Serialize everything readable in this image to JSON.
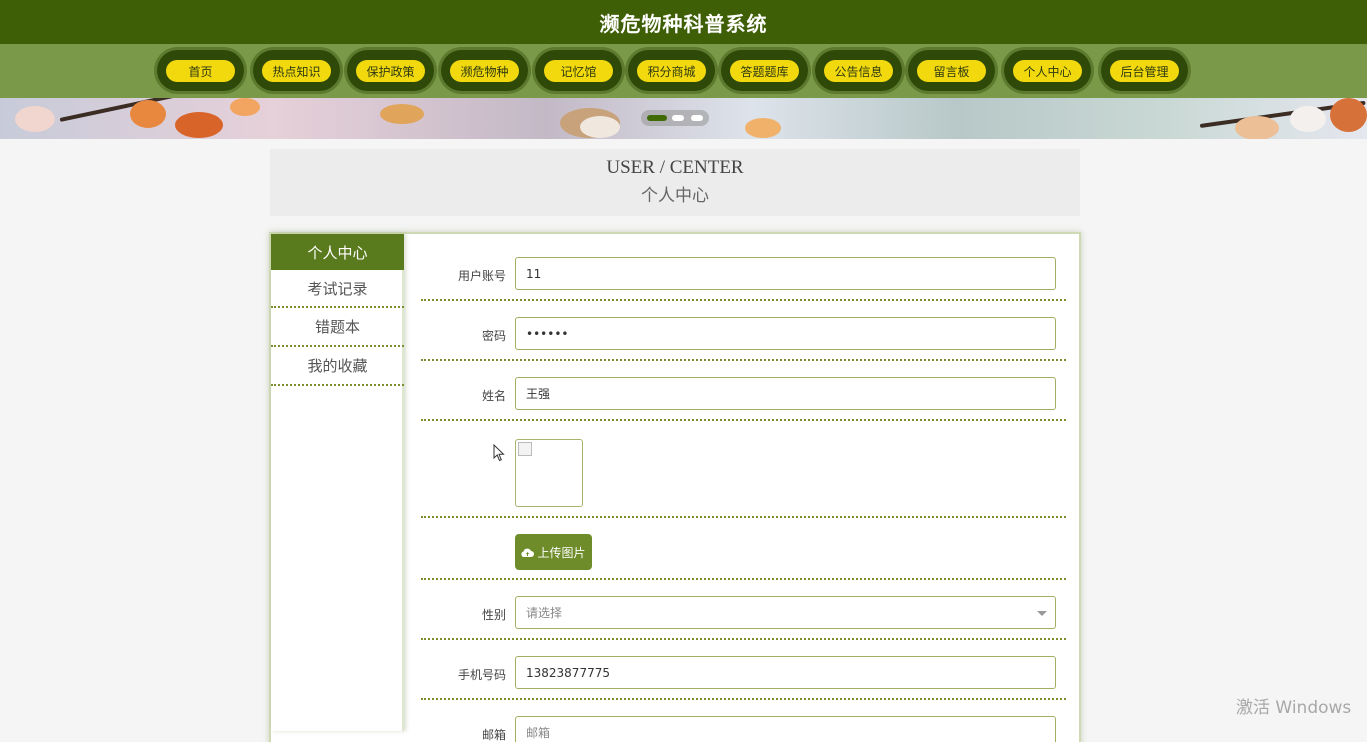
{
  "header": {
    "title": "濒危物种科普系统"
  },
  "nav": {
    "items": [
      {
        "label": "首页"
      },
      {
        "label": "热点知识"
      },
      {
        "label": "保护政策"
      },
      {
        "label": "濒危物种"
      },
      {
        "label": "记忆馆"
      },
      {
        "label": "积分商城"
      },
      {
        "label": "答题题库"
      },
      {
        "label": "公告信息"
      },
      {
        "label": "留言板"
      },
      {
        "label": "个人中心"
      },
      {
        "label": "后台管理"
      }
    ]
  },
  "banner": {
    "slides": 3,
    "active_slide": 1
  },
  "center_header": {
    "en": "USER / CENTER",
    "cn": "个人中心"
  },
  "sidebar": {
    "items": [
      {
        "label": "个人中心",
        "active": true
      },
      {
        "label": "考试记录",
        "active": false
      },
      {
        "label": "错题本",
        "active": false
      },
      {
        "label": "我的收藏",
        "active": false
      }
    ]
  },
  "form": {
    "account_label": "用户账号",
    "account_value": "11",
    "password_label": "密码",
    "password_value": "••••••",
    "name_label": "姓名",
    "name_value": "王强",
    "upload_label": "上传图片",
    "gender_label": "性别",
    "gender_placeholder": "请选择",
    "phone_label": "手机号码",
    "phone_value": "13823877775",
    "email_label": "邮箱",
    "email_placeholder": "邮箱"
  },
  "colors": {
    "header": "#3f5f06",
    "nav": "#7b9a49",
    "pill": "#f2d90e",
    "accent": "#5a7a1e"
  },
  "watermark": "激活 Windows"
}
